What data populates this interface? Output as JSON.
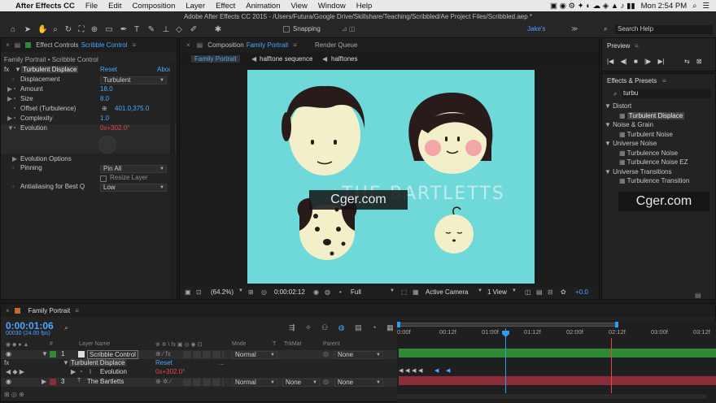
{
  "menubar": {
    "app": "After Effects CC",
    "items": [
      "File",
      "Edit",
      "Composition",
      "Layer",
      "Effect",
      "Animation",
      "View",
      "Window",
      "Help"
    ],
    "clock": "Mon 2:54 PM"
  },
  "toolbar": {
    "window_title": "Adobe After Effects CC 2015 - /Users/Futura/Google Drive/Skillshare/Teaching/Scribbled/Ae Project Files/Scribbled.aep *",
    "snapping": "Snapping",
    "workspace": "Jake's",
    "search": "Search Help"
  },
  "effect_controls": {
    "tab_prefix": "Effect Controls",
    "tab_layer": "Scribble Control",
    "breadcrumb": "Family Portrait • Scribble Control",
    "effect_name": "Turbulent Displace",
    "reset": "Reset",
    "about": "Abou",
    "props": [
      {
        "name": "Displacement",
        "value": "Turbulent"
      },
      {
        "name": "Amount",
        "value": "18.0"
      },
      {
        "name": "Size",
        "value": "8.0"
      },
      {
        "name": "Offset (Turbulence)",
        "value": "401.0,375.0"
      },
      {
        "name": "Complexity",
        "value": "1.0"
      },
      {
        "name": "Evolution",
        "value": "0x+302.0°"
      }
    ],
    "evolution_options": "Evolution Options",
    "pinning_label": "Pinning",
    "pinning_value": "Pin All",
    "resize_layer": "Resize Layer",
    "aa_label": "Antialiasing for Best Q",
    "aa_value": "Low"
  },
  "composition": {
    "tab_prefix": "Composition",
    "tab_name": "Family Portrait",
    "render_queue": "Render Queue",
    "flow": [
      "Family Portrait",
      "halftone sequence",
      "halftones"
    ],
    "canvas_text": "THE BARTLETTS",
    "bottom": {
      "zoom": "(64.2%)",
      "timecode": "0:00:02:12",
      "resolution": "Full",
      "camera": "Active Camera",
      "views": "1 View",
      "offset": "+0.0"
    },
    "bg_color": "#6fd8d8"
  },
  "watermark": "Cger.com",
  "preview": {
    "title": "Preview"
  },
  "effects_presets": {
    "title": "Effects & Presets",
    "search_value": "turbu",
    "groups": [
      {
        "name": "Distort",
        "items": [
          "Turbulent Displace"
        ]
      },
      {
        "name": "Noise & Grain",
        "items": [
          "Turbulent Noise"
        ]
      },
      {
        "name": "Universe Noise",
        "items": [
          "Turbulence Noise",
          "Turbulence Noise EZ"
        ]
      },
      {
        "name": "Universe Transitions",
        "items": [
          "Turbulence Transition"
        ]
      }
    ]
  },
  "timeline": {
    "tab": "Family Portrait",
    "timecode": "0:00:01:06",
    "frames": "00030 (24.00 fps)",
    "columns": {
      "layer_name": "Layer Name",
      "mode": "Mode",
      "t": "T",
      "trkmat": "TrkMat",
      "parent": "Parent"
    },
    "ruler": [
      "0:00f",
      "00:12f",
      "01:00f",
      "01:12f",
      "02:00f",
      "02:12f",
      "03:00f",
      "03:12f"
    ],
    "layers": [
      {
        "num": "1",
        "name": "Scribble Control",
        "mode": "Normal",
        "trkmat": "",
        "parent": "None"
      },
      {
        "num": "3",
        "name": "The Bartletts",
        "mode": "Normal",
        "trkmat": "None",
        "parent": "None"
      }
    ],
    "effect_row": {
      "name": "Turbulent Displace",
      "reset": "Reset",
      "dots": "..."
    },
    "prop_row": {
      "name": "Evolution",
      "value": "0x+302.0°"
    },
    "layer1_color": "#2f8a38",
    "layer3_color": "#8b2d38"
  }
}
